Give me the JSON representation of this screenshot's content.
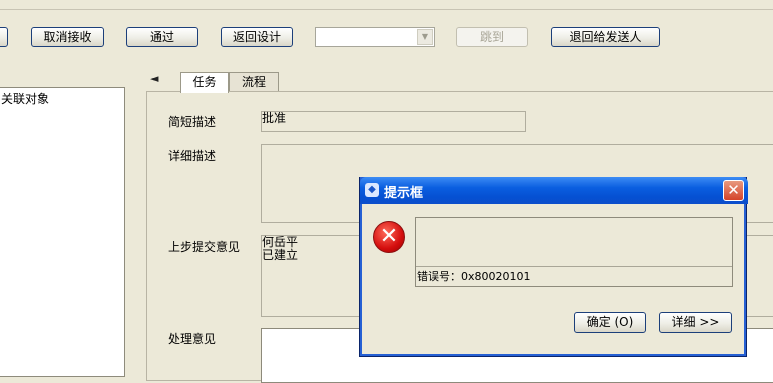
{
  "toolbar": {
    "cancel_receive": "取消接收",
    "approve": "通过",
    "return_design": "返回设计",
    "jump": "跳到",
    "return_sender": "退回给发送人",
    "jump_select_value": ""
  },
  "left_panel": {
    "item": "关联对象"
  },
  "tabs": [
    {
      "label": "任务"
    },
    {
      "label": "流程"
    }
  ],
  "form": {
    "short_desc_label": "简短描述",
    "short_desc_value": "批准",
    "detail_desc_label": "详细描述",
    "detail_desc_value": "",
    "prev_opinion_label": "上步提交意见",
    "prev_opinion_line1": "何岳平",
    "prev_opinion_line2": "已建立",
    "handle_opinion_label": "处理意见",
    "handle_opinion_value": ""
  },
  "dialog": {
    "title": "提示框",
    "close_glyph": "✕",
    "error_glyph": "✕",
    "message_top": "",
    "message": "错误号：0x80020101",
    "ok_label": "确定 (O)",
    "details_label": "详细 >>"
  }
}
